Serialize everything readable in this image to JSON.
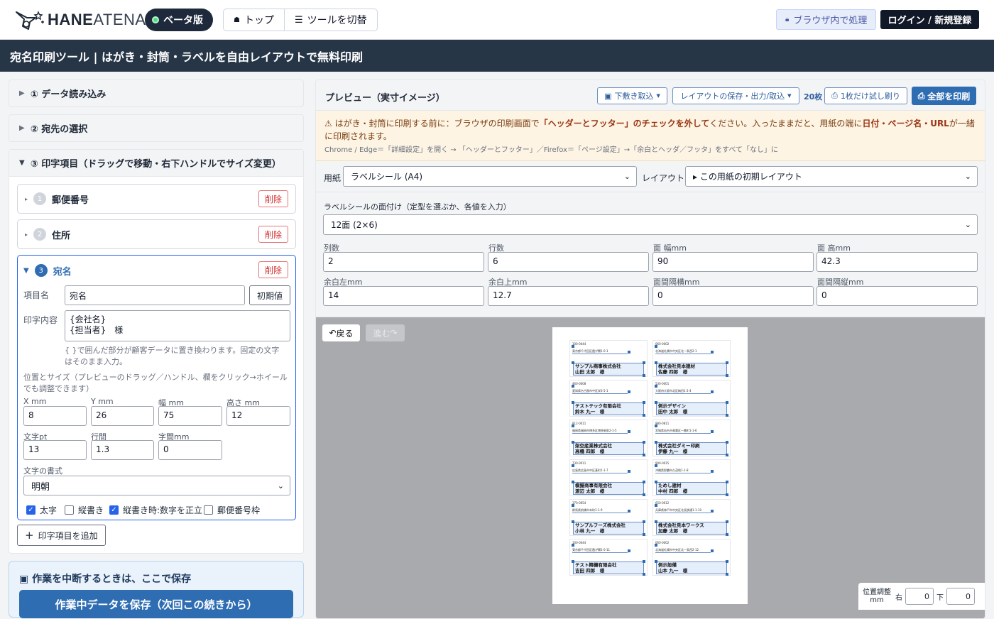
{
  "header": {
    "logo_text_bold": "HANE",
    "logo_text_light": "ATENA",
    "beta": "ベータ版",
    "nav_top": "トップ",
    "nav_switch": "ツールを切替",
    "local_badge": "ブラウザ内で処理",
    "login": "ログイン / 新規登録"
  },
  "title": "宛名印刷ツール | はがき・封筒・ラベルを自由レイアウトで無料印刷",
  "left": {
    "sec1": "① データ読み込み",
    "sec2": "② 宛先の選択",
    "sec3": "③ 印字項目（ドラッグで移動・右下ハンドルでサイズ変更）",
    "items": [
      {
        "num": "1",
        "name": "郵便番号",
        "del": "削除"
      },
      {
        "num": "2",
        "name": "住所",
        "del": "削除"
      },
      {
        "num": "3",
        "name": "宛名",
        "del": "削除"
      }
    ],
    "field_name_label": "項目名",
    "field_name_value": "宛名",
    "reset_btn": "初期値",
    "content_label": "印字内容",
    "content_line1": "{会社名}",
    "content_line2": "{担当者}　様",
    "content_help": "{ }で囲んだ部分が顧客データに置き換わります。固定の文字はそのまま入力。",
    "pos_help": "位置とサイズ（プレビューのドラッグ／ハンドル、欄をクリック→ホイールでも調整できます）",
    "x_label": "X mm",
    "x_value": "8",
    "y_label": "Y mm",
    "y_value": "26",
    "w_label": "幅 mm",
    "w_value": "75",
    "h_label": "高さ mm",
    "h_value": "12",
    "pt_label": "文字pt",
    "pt_value": "13",
    "lh_label": "行間",
    "lh_value": "1.3",
    "ls_label": "字間mm",
    "ls_value": "0",
    "font_label": "文字の書式",
    "font_value": "明朝",
    "cb_bold": "太字",
    "cb_vertical": "縦書き",
    "cb_upright": "縦書き時:数字を正立",
    "cb_zipbox": "郵便番号枠",
    "add_item": "印字項目を追加",
    "save_title": "作業を中断するときは、ここで保存",
    "save_btn": "作業中データを保存（次回この続きから）"
  },
  "right": {
    "preview_title": "プレビュー（実寸イメージ）",
    "bg_import": "下敷き取込",
    "layout_save": "レイアウトの保存・出力/取込",
    "count": "20枚",
    "test_print": "1枚だけ試し刷り",
    "print_all": "全部を印刷",
    "warn_main_pre": "はがき・封筒に印刷する前に：ブラウザの印刷画面で",
    "warn_main_b1": "「ヘッダーとフッター」のチェックを外して",
    "warn_main_mid": "ください。入ったままだと、用紙の端に",
    "warn_main_b2": "日付・ページ名・URL",
    "warn_main_post": "が一緒に印刷されます。",
    "warn_sub": "Chrome / Edge＝「詳細設定」を開く → 「ヘッダーとフッター」／Firefox＝「ページ設定」→「余白とヘッダ／フッタ」をすべて「なし」に",
    "paper_label": "用紙",
    "paper_value": "ラベルシール (A4)",
    "layout_label": "レイアウト",
    "layout_value": "▸ この用紙の初期レイアウト",
    "face_title": "ラベルシールの面付け（定型を選ぶか、各値を入力）",
    "face_value": "12面 (2×6)",
    "cols_label": "列数",
    "cols_value": "2",
    "rows_label": "行数",
    "rows_value": "6",
    "fw_label": "面 幅mm",
    "fw_value": "90",
    "fh_label": "面 高mm",
    "fh_value": "42.3",
    "ml_label": "余白左mm",
    "ml_value": "14",
    "mt_label": "余白上mm",
    "mt_value": "12.7",
    "gx_label": "面間隔横mm",
    "gx_value": "0",
    "gy_label": "面間隔縦mm",
    "gy_value": "0",
    "back_btn": "戻る",
    "fwd_btn": "進む",
    "pos_label": "位置調整",
    "pos_unit": "mm",
    "pos_right": "右",
    "pos_right_val": "0",
    "pos_down": "下",
    "pos_down_val": "0"
  },
  "labels": [
    {
      "zip": "100-0044",
      "addr": "東京都千代田区霞が関1-0-1",
      "company": "サンプル商事株式会社",
      "person": "山田 太郎　様"
    },
    {
      "zip": "060-0002",
      "addr": "北海道札幌市中央区北一条西2-1",
      "company": "株式会社見本建材",
      "person": "佐藤 四郎　様"
    },
    {
      "zip": "460-0008",
      "addr": "愛知県名古屋市中区栄3-5-1",
      "company": "テストテック有限会社",
      "person": "鈴木 九一　様"
    },
    {
      "zip": "530-0001",
      "addr": "大阪府大阪市北区梅田1-2-4",
      "company": "例示デザイン",
      "person": "田中 太郎　様"
    },
    {
      "zip": "812-0011",
      "addr": "福岡県福岡市博多区博多駅前2-1-5",
      "company": "架空産業株式会社",
      "person": "高橋 四郎　様"
    },
    {
      "zip": "980-0811",
      "addr": "宮城県仙台市青葉区一番町1-1-6",
      "company": "株式会社ダミー印刷",
      "person": "伊藤 九一　様"
    },
    {
      "zip": "730-0011",
      "addr": "広島県広島市中区基町1-1-7",
      "company": "模擬商事有限会社",
      "person": "渡辺 太郎　様"
    },
    {
      "zip": "900-0015",
      "addr": "沖縄県那覇市久茂地1-1-8",
      "company": "ためし建材",
      "person": "中村 四郎　様"
    },
    {
      "zip": "370-0654",
      "addr": "群馬県前橋市本町1-1-9",
      "company": "サンプルフーズ株式会社",
      "person": "小林 九一　様"
    },
    {
      "zip": "650-0012",
      "addr": "兵庫県神戸市中央区北長狭通1-1-10",
      "company": "株式会社見本ワークス",
      "person": "加藤 太郎　様"
    },
    {
      "zip": "100-0044",
      "addr": "東京都千代田区霞が関1-0-11",
      "company": "テスト精機有限会社",
      "person": "吉田 四郎　様"
    },
    {
      "zip": "060-0002",
      "addr": "北海道札幌市中央区北一条西2-12",
      "company": "例示設備",
      "person": "山本 九一　様"
    }
  ]
}
